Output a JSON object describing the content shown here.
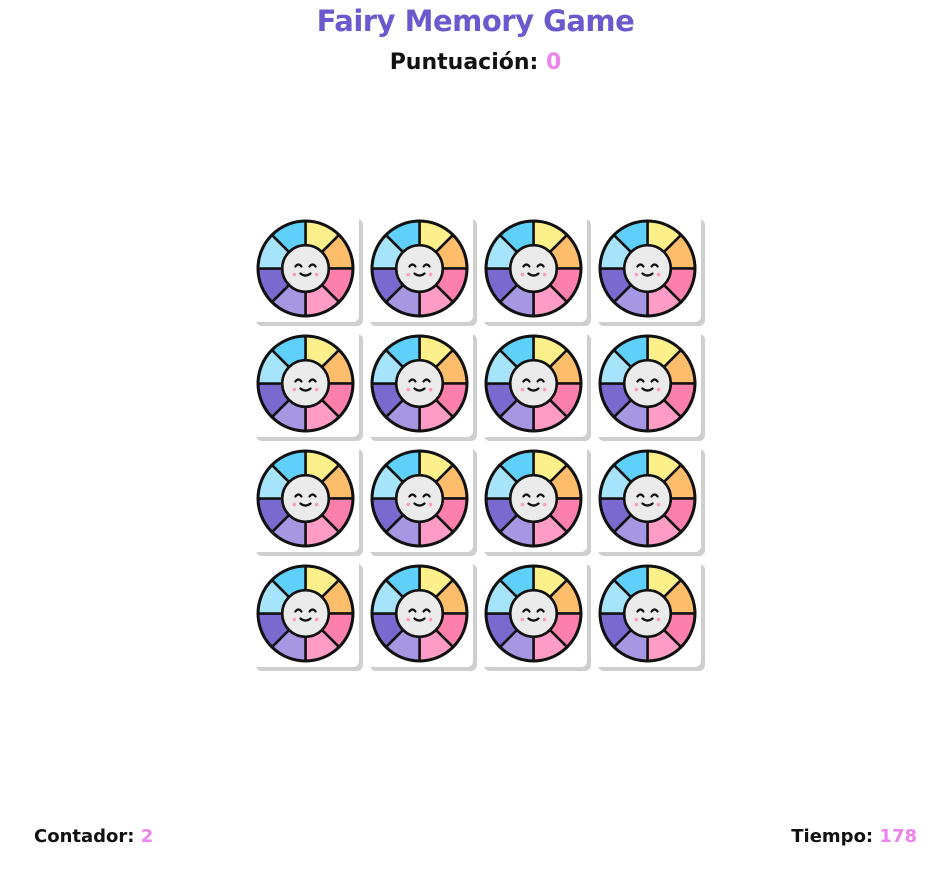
{
  "header": {
    "title": "Fairy Memory Game",
    "score_label": "Puntuación:",
    "score_value": "0"
  },
  "board": {
    "rows": 4,
    "columns": 4,
    "card_back_icon": "smiling-color-wheel-icon",
    "wheel_colors": [
      "#fdf08a",
      "#fdbd6a",
      "#fd7fab",
      "#fe9cc6",
      "#a796e2",
      "#7a6ad0",
      "#a6e4fb",
      "#5fd0f9"
    ]
  },
  "footer": {
    "counter_label": "Contador:",
    "counter_value": "2",
    "time_label": "Tiempo:",
    "time_value": "178"
  },
  "colors": {
    "title": "#6a5acd",
    "accent": "#ee82ee"
  }
}
